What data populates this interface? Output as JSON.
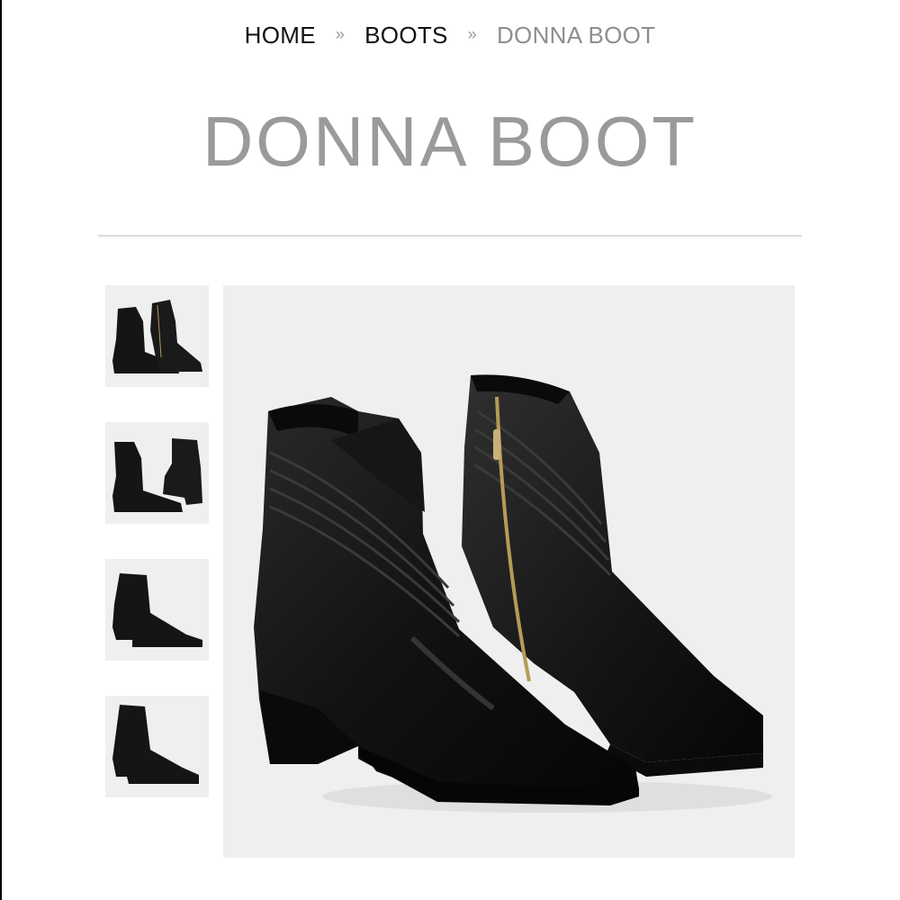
{
  "breadcrumb": {
    "home": "HOME",
    "separator1": "»",
    "category": "BOOTS",
    "separator2": "»",
    "current": "DONNA BOOT"
  },
  "product": {
    "title": "DONNA BOOT"
  },
  "gallery": {
    "thumbnails": [
      {
        "name": "thumbnail-pair-front"
      },
      {
        "name": "thumbnail-pair-angle"
      },
      {
        "name": "thumbnail-side-profile"
      },
      {
        "name": "thumbnail-three-quarter"
      }
    ],
    "main_image": "boot-pair-main-image"
  },
  "colors": {
    "title": "#9a9a9a",
    "image_bg": "#efefef",
    "boot": "#141414",
    "zipper": "#b79a57"
  }
}
